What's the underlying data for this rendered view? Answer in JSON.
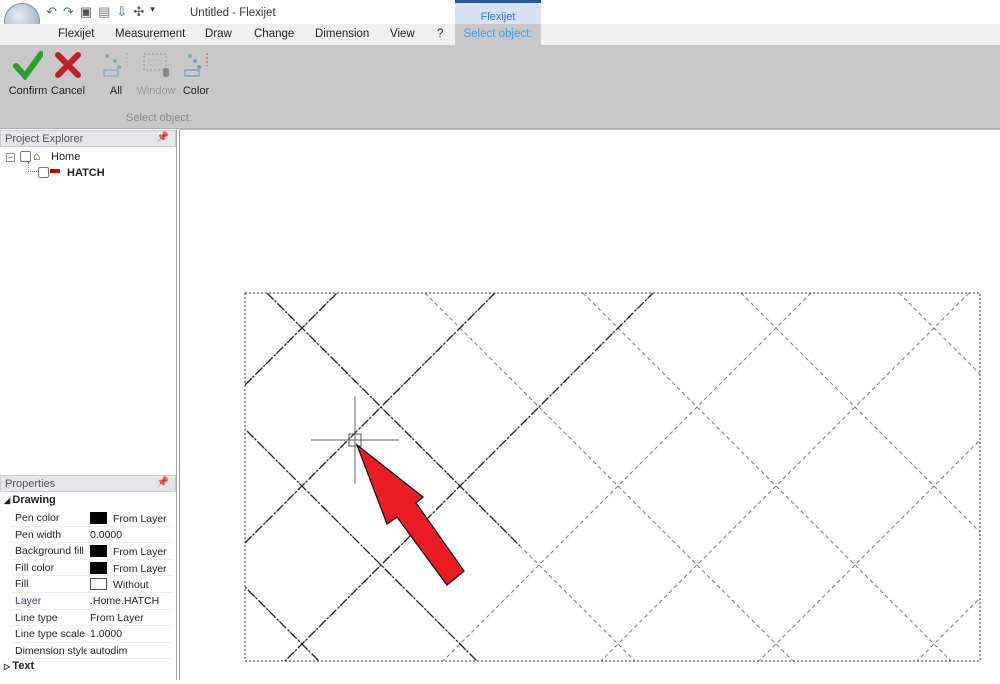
{
  "titlebar": {
    "doc_title": "Untitled - Flexijet",
    "quick_access": [
      "undo-icon",
      "redo-icon",
      "save-icon",
      "layout-icon",
      "export-icon",
      "gamepad-icon"
    ],
    "context_group": "Flexijet"
  },
  "tabs": [
    {
      "label": "Flexijet"
    },
    {
      "label": "Measurement"
    },
    {
      "label": "Draw"
    },
    {
      "label": "Change"
    },
    {
      "label": "Dimension"
    },
    {
      "label": "View"
    },
    {
      "label": "?"
    }
  ],
  "context_tab": {
    "label": "Select object:",
    "active_color": "#3a9af0"
  },
  "ribbon": {
    "buttons": [
      {
        "label": "Confirm",
        "icon": "check-icon",
        "enabled": true
      },
      {
        "label": "Cancel",
        "icon": "cross-icon",
        "enabled": true
      },
      {
        "label": "All",
        "icon": "select-all-icon",
        "enabled": true
      },
      {
        "label": "Window",
        "icon": "select-window-icon",
        "enabled": false
      },
      {
        "label": "Color",
        "icon": "select-color-icon",
        "enabled": true
      }
    ],
    "group_label": "Select object:"
  },
  "explorer": {
    "title": "Project Explorer",
    "tree": [
      {
        "label": "Home"
      },
      {
        "label": "HATCH"
      }
    ]
  },
  "properties": {
    "title": "Properties",
    "section": "Drawing",
    "rows": [
      {
        "key": "Pen color",
        "value": "From Layer",
        "swatch": "#000000"
      },
      {
        "key": "Pen width",
        "value": "0.0000"
      },
      {
        "key": "Background fill",
        "value": "From Layer",
        "swatch": "#000000"
      },
      {
        "key": "Fill color",
        "value": "From Layer",
        "swatch": "#000000"
      },
      {
        "key": "Fill",
        "value": "Without",
        "swatch": "#ffffff"
      },
      {
        "key": "Layer",
        "value": ".Home.HATCH"
      },
      {
        "key": "Line type",
        "value": "From Layer"
      },
      {
        "key": "Line type scale f",
        "value": "1.0000"
      },
      {
        "key": "Dimension style",
        "value": "autodim"
      }
    ],
    "collapsed_section": "Text"
  },
  "colors": {
    "arrow": "#ed1c24",
    "ribbon_bg": "#c8c8c8",
    "layer_key": "#3333cc"
  }
}
